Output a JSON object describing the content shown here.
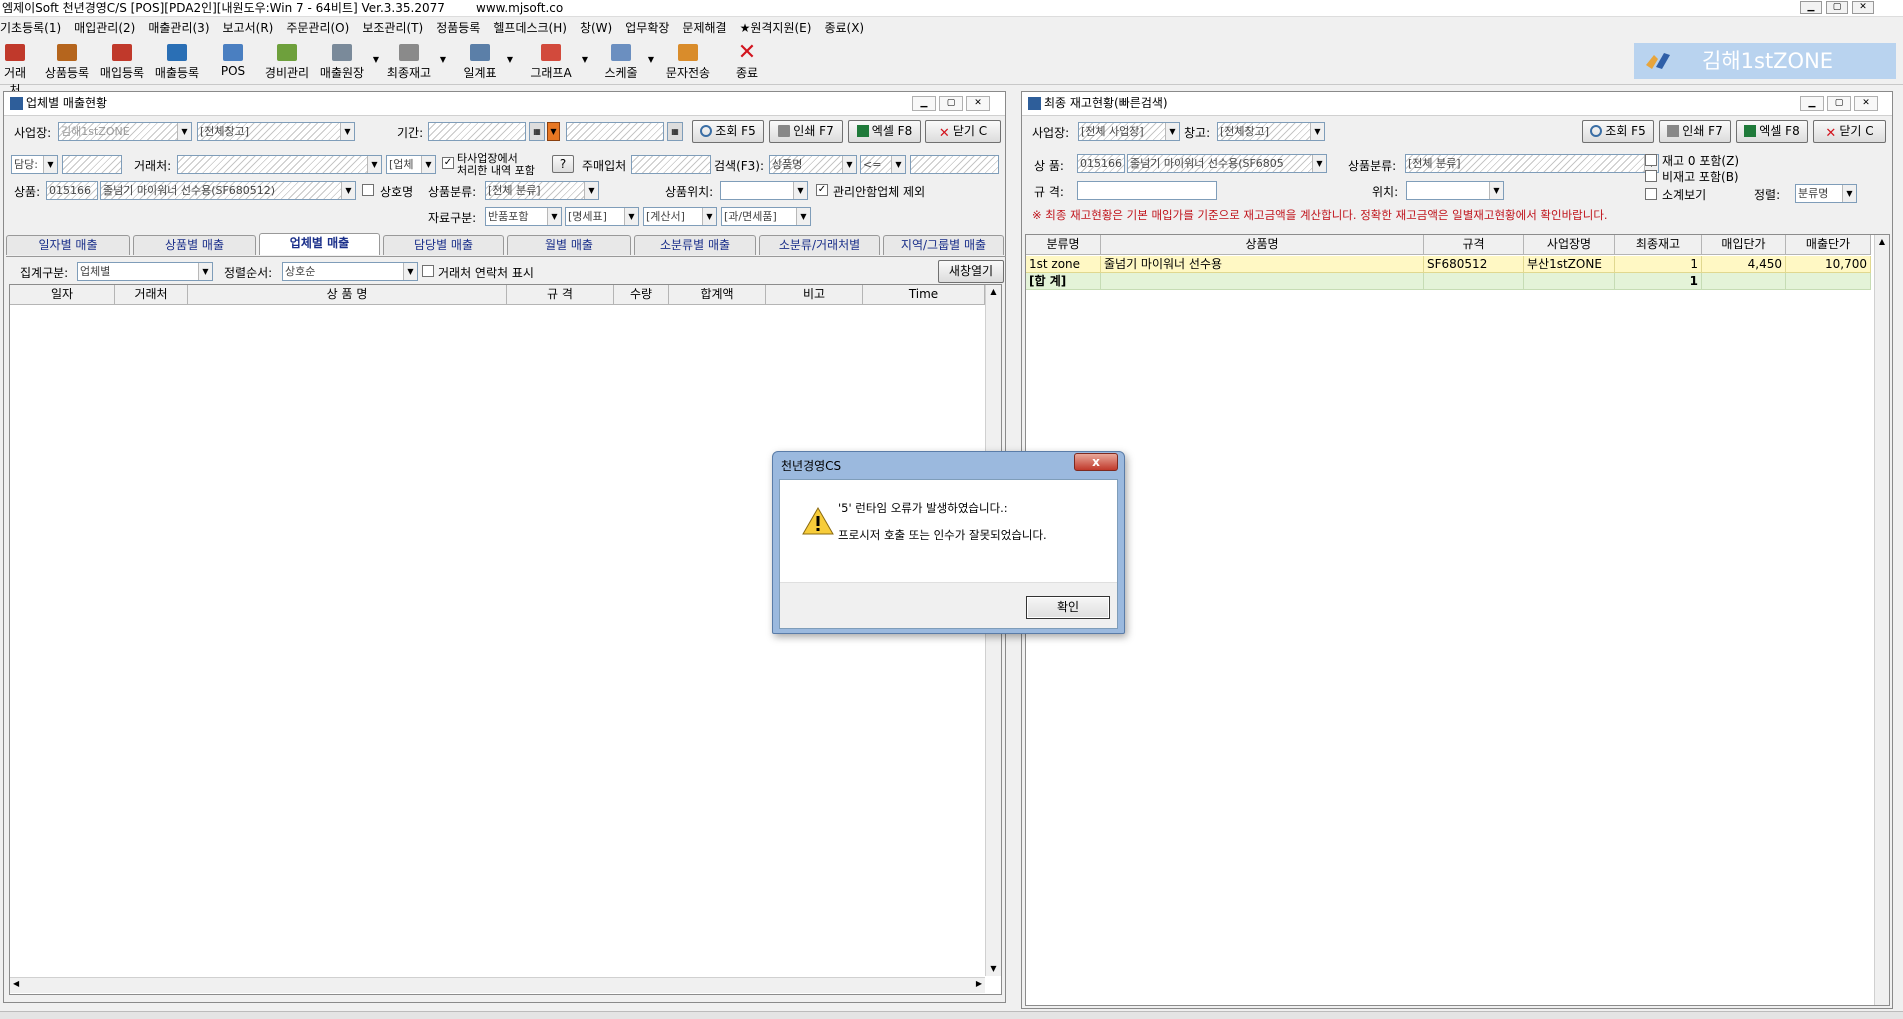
{
  "app": {
    "title": "엠제이Soft 천년경영C/S [POS][PDA2인][내원도우:Win 7 - 64비트] Ver.3.35.2077",
    "url": "www.mjsoft.co"
  },
  "menu": [
    "기초등록(1)",
    "매입관리(2)",
    "매출관리(3)",
    "보고서(R)",
    "주문관리(O)",
    "보조관리(T)",
    "정품등록",
    "헬프데스크(H)",
    "창(W)",
    "업무확장",
    "문제해결",
    "★원격지원(E)",
    "종료(X)"
  ],
  "toolbar": [
    {
      "label": "거래처",
      "color": "#c0392b"
    },
    {
      "label": "상품등록",
      "color": "#b5651d"
    },
    {
      "label": "매입등록",
      "color": "#c0392b"
    },
    {
      "label": "매출등록",
      "color": "#2a6fb5"
    },
    {
      "label": "POS",
      "color": "#4a7fc1"
    },
    {
      "label": "경비관리",
      "color": "#6ea03c"
    },
    {
      "label": "매출원장",
      "color": "#7a8a9a"
    },
    {
      "label": "최종재고",
      "color": "#8a8a8a"
    },
    {
      "label": "일계표",
      "color": "#5b7fa8"
    },
    {
      "label": "그래프A",
      "color": "#d24a3c"
    },
    {
      "label": "스케줄",
      "color": "#6b8fc0"
    },
    {
      "label": "문자전송",
      "color": "#d98c2b"
    },
    {
      "label": "종료",
      "color": "#d2141e"
    }
  ],
  "banner": {
    "text": "김해1stZONE"
  },
  "left_panel": {
    "title": "업체별 매출현황",
    "labels": {
      "business": "사업장:",
      "business_value": "김해1stZONE",
      "warehouse_value": "[전체창고]",
      "period": "기간:",
      "search_btn": "조회 F5",
      "print_btn": "인쇄 F7",
      "excel_btn": "엑셀 F8",
      "close_btn": "닫기 C",
      "manager": "담당:",
      "client": "거래처:",
      "client_type": "[업체",
      "other_store_1": "타사업장에서",
      "other_store_2": "처리한 내역 포함",
      "help": "?",
      "main_vendor": "주매입처",
      "search_f3": "검색(F3):",
      "search_mode": "상품명",
      "op": "<=",
      "product": "상품:",
      "product_code": "015166",
      "product_name": "줄넘기 마이워너 선수용(SF680512)",
      "by_name": "상호명",
      "category": "상품분류:",
      "category_value": "[전체 분류]",
      "location": "상품위치:",
      "exclude_unmanaged": "관리안함업체 제외",
      "data_type": "자료구분:",
      "dt1": "반품포함",
      "dt2": "[명세표]",
      "dt3": "[계산서]",
      "dt4": "[과/면세품]",
      "agg": "집계구분:",
      "agg_value": "업체별",
      "sort": "정렬순서:",
      "sort_value": "상호순",
      "show_contact": "거래처 연락처 표시",
      "new_window": "새창열기"
    },
    "tabs": [
      "일자별 매출",
      "상품별 매출",
      "업체별 매출",
      "담당별 매출",
      "월별 매출",
      "소분류별 매출",
      "소분류/거래처별",
      "지역/그룹별 매출"
    ],
    "columns": [
      "일자",
      "거래처",
      "상 품 명",
      "규 격",
      "수량",
      "합계액",
      "비고",
      "Time"
    ]
  },
  "right_panel": {
    "title": "최종 재고현황(빠른검색)",
    "labels": {
      "business": "사업장:",
      "business_value": "[전체 사업장]",
      "warehouse": "창고:",
      "warehouse_value": "[전체창고]",
      "search_btn": "조회 F5",
      "print_btn": "인쇄 F7",
      "excel_btn": "엑셀 F8",
      "close_btn": "닫기 C",
      "product": "상 품:",
      "product_code": "015166",
      "product_name": "줄넘기 마이워너 선수용(SF6805",
      "category": "상품분류:",
      "category_value": "[전체 분류]",
      "zero_stock": "재고 0 포함(Z)",
      "non_stock": "비재고 포함(B)",
      "spec": "규 격:",
      "location": "위치:",
      "subtotal": "소계보기",
      "sort": "정렬:",
      "sort_value": "분류명",
      "notice": "※ 최종 재고현황은 기본 매입가를 기준으로 재고금액을 계산합니다. 정확한 재고금액은 일별재고현황에서 확인바랍니다."
    },
    "columns": [
      "분류명",
      "상품명",
      "규격",
      "사업장명",
      "최종재고",
      "매입단가",
      "매출단가"
    ],
    "rows": [
      [
        "1st zone",
        "줄넘기 마이워너 선수용",
        "SF680512",
        "부산1stZONE",
        "1",
        "4,450",
        "10,700"
      ]
    ],
    "total": {
      "label": "[합 계]",
      "stock": "1"
    }
  },
  "dialog": {
    "title": "천년경영CS",
    "close": "x",
    "line1": "'5' 런타임 오류가 발생하였습니다.:",
    "line2": "프로시저 호출 또는 인수가 잘못되었습니다.",
    "ok": "확인"
  }
}
